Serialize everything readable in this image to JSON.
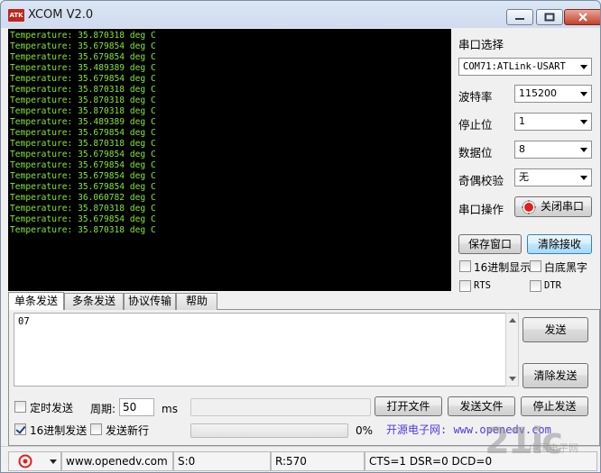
{
  "window": {
    "title": "XCOM V2.0",
    "logo_text": "ATK"
  },
  "receive_log": [
    "Temperature: 35.870318 deg C",
    "Temperature: 35.679854 deg C",
    "Temperature: 35.679854 deg C",
    "Temperature: 35.489389 deg C",
    "Temperature: 35.679854 deg C",
    "Temperature: 35.870318 deg C",
    "Temperature: 35.870318 deg C",
    "Temperature: 35.870318 deg C",
    "Temperature: 35.489389 deg C",
    "Temperature: 35.679854 deg C",
    "Temperature: 35.870318 deg C",
    "Temperature: 35.679854 deg C",
    "Temperature: 35.679854 deg C",
    "Temperature: 35.679854 deg C",
    "Temperature: 35.679854 deg C",
    "Temperature: 36.060782 deg C",
    "Temperature: 35.870318 deg C",
    "Temperature: 35.679854 deg C",
    "Temperature: 35.870318 deg C"
  ],
  "settings": {
    "port_label": "串口选择",
    "port_value": "COM71:ATLink-USART",
    "baud_label": "波特率",
    "baud_value": "115200",
    "stopbits_label": "停止位",
    "stopbits_value": "1",
    "databits_label": "数据位",
    "databits_value": "8",
    "parity_label": "奇偶校验",
    "parity_value": "无",
    "port_op_label": "串口操作",
    "port_op_button": "关闭串口"
  },
  "receive_controls": {
    "save_window": "保存窗口",
    "clear_receive": "清除接收",
    "hex_display": "16进制显示",
    "white_bg": "白底黑字",
    "rts": "RTS",
    "dtr": "DTR"
  },
  "tabs": [
    "单条发送",
    "多条发送",
    "协议传输",
    "帮助"
  ],
  "send": {
    "content": "07",
    "send_button": "发送",
    "clear_send_button": "清除发送",
    "timed_send": "定时发送",
    "period_label": "周期:",
    "period_value": "50",
    "period_unit": "ms",
    "hex_send": "16进制发送",
    "send_newline": "发送新行",
    "open_file": "打开文件",
    "send_file": "发送文件",
    "stop_send": "停止发送",
    "progress_percent": "0%",
    "progress_value": 0,
    "website": "开源电子网: www.openedv.com"
  },
  "statusbar": {
    "site": "www.openedv.com",
    "sent": "S:0",
    "received": "R:570",
    "lines": "CTS=1 DSR=0 DCD=0"
  },
  "watermark": {
    "logo": "21ic",
    "text": "中国电子网"
  },
  "colors": {
    "terminal_bg": "#000000",
    "terminal_fg": "#83e635",
    "record_icon": "#e0201a",
    "website_text": "#4f3ae0"
  }
}
